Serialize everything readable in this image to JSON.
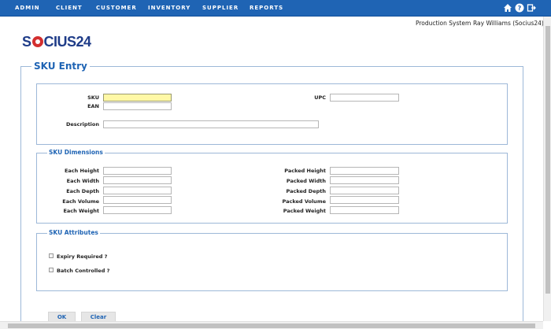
{
  "nav": {
    "items": [
      "ADMIN",
      "CLIENT",
      "CUSTOMER",
      "INVENTORY",
      "SUPPLIER",
      "REPORTS"
    ],
    "icons": [
      "home-icon",
      "help-icon",
      "logout-icon"
    ]
  },
  "userbar": {
    "environment": "Production System",
    "user": "Ray Williams (Socius24)"
  },
  "logo": {
    "prefix": "S",
    "suffix": "CIUS24"
  },
  "page": {
    "title": "SKU Entry"
  },
  "sku_section": {
    "sku_label": "SKU",
    "ean_label": "EAN",
    "upc_label": "UPC",
    "description_label": "Description"
  },
  "dimensions": {
    "title": "SKU Dimensions",
    "each": [
      "Each Height",
      "Each Width",
      "Each Depth",
      "Each Volume",
      "Each Weight"
    ],
    "packed": [
      "Packed Height",
      "Packed Width",
      "Packed Depth",
      "Packed Volume",
      "Packed Weight"
    ]
  },
  "attributes": {
    "title": "SKU Attributes",
    "expiry_label": "Expiry Required ?",
    "batch_label": "Batch Controlled ?"
  },
  "buttons": {
    "ok": "OK",
    "clear": "Clear"
  },
  "colors": {
    "nav_bg": "#1f64b4",
    "accent": "#1f64b4",
    "highlight_input": "#fff8a6",
    "logo_red": "#d32f2f"
  }
}
